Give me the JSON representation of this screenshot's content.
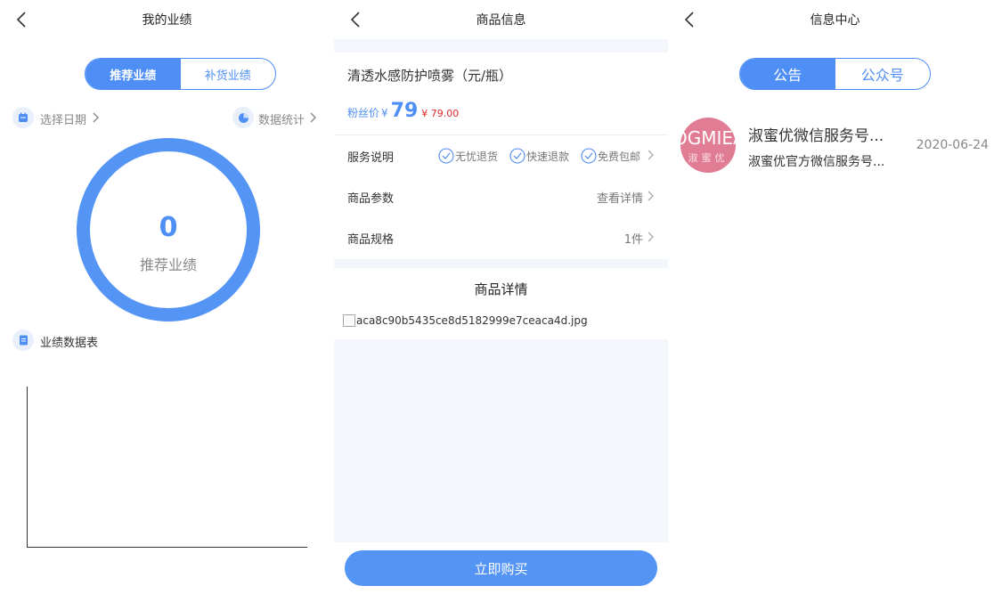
{
  "performance": {
    "title": "我的业绩",
    "tabs": [
      {
        "label": "推荐业绩",
        "active": true
      },
      {
        "label": "补货业绩",
        "active": false
      }
    ],
    "date_picker_label": "选择日期",
    "stats_label": "数据统计",
    "ring_value": "0",
    "ring_label": "推荐业绩",
    "table_label": "业绩数据表"
  },
  "product": {
    "title": "商品信息",
    "name": "清透水感防护喷雾（元/瓶）",
    "fans_price_label": "粉丝价",
    "currency": "¥",
    "fans_price": "79",
    "original_price": "¥ 79.00",
    "service_label": "服务说明",
    "services": [
      "无忧退货",
      "快速退款",
      "免费包邮"
    ],
    "params_label": "商品参数",
    "params_value": "查看详情",
    "spec_label": "商品规格",
    "spec_value": "1件",
    "detail_title": "商品详情",
    "detail_image_alt": "aca8c90b5435ce8d5182999e7ceaca4d.jpg",
    "buy_label": "立即购买"
  },
  "info_center": {
    "title": "信息中心",
    "tabs": [
      {
        "label": "公告",
        "active": true
      },
      {
        "label": "公众号",
        "active": false
      }
    ],
    "messages": [
      {
        "avatar_text": "OGMIEA",
        "avatar_sub": "淑蜜优",
        "title": "淑蜜优微信服务号...",
        "desc": "淑蜜优官方微信服务号...",
        "date": "2020-06-24"
      }
    ]
  },
  "colors": {
    "accent": "#4f8ff5",
    "price_red": "#e02a2a",
    "avatar_pink": "#e07c94",
    "section_gray": "#f3f6fb"
  }
}
